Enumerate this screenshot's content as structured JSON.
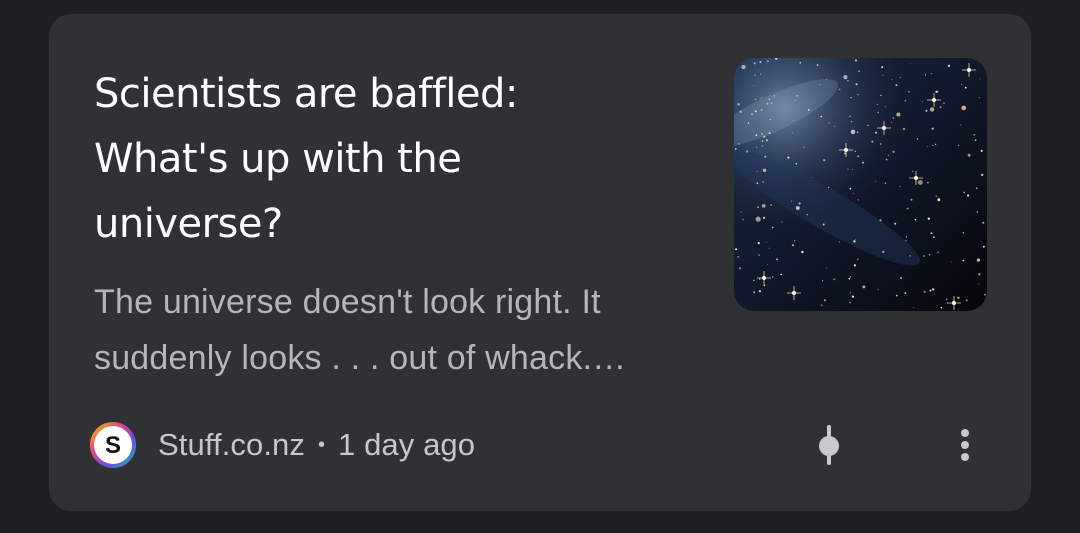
{
  "card": {
    "headline": "Scientists are baffled: What's up with the universe?",
    "snippet": "The universe doesn't look right. It suddenly looks . . . out of whack.…",
    "source": {
      "name": "Stuff.co.nz",
      "logo_letter": "S",
      "logo_icon": "stuff-logo-icon"
    },
    "separator": "•",
    "age": "1 day ago",
    "thumbnail_icon": "starfield-image",
    "actions": {
      "tune_icon": "tune-icon",
      "more_icon": "more-vert-icon"
    }
  },
  "colors": {
    "background": "#1f1f21",
    "card": "#303134",
    "headline": "#ffffff",
    "snippet": "#b5b6b9",
    "meta": "#c6c7ca"
  }
}
